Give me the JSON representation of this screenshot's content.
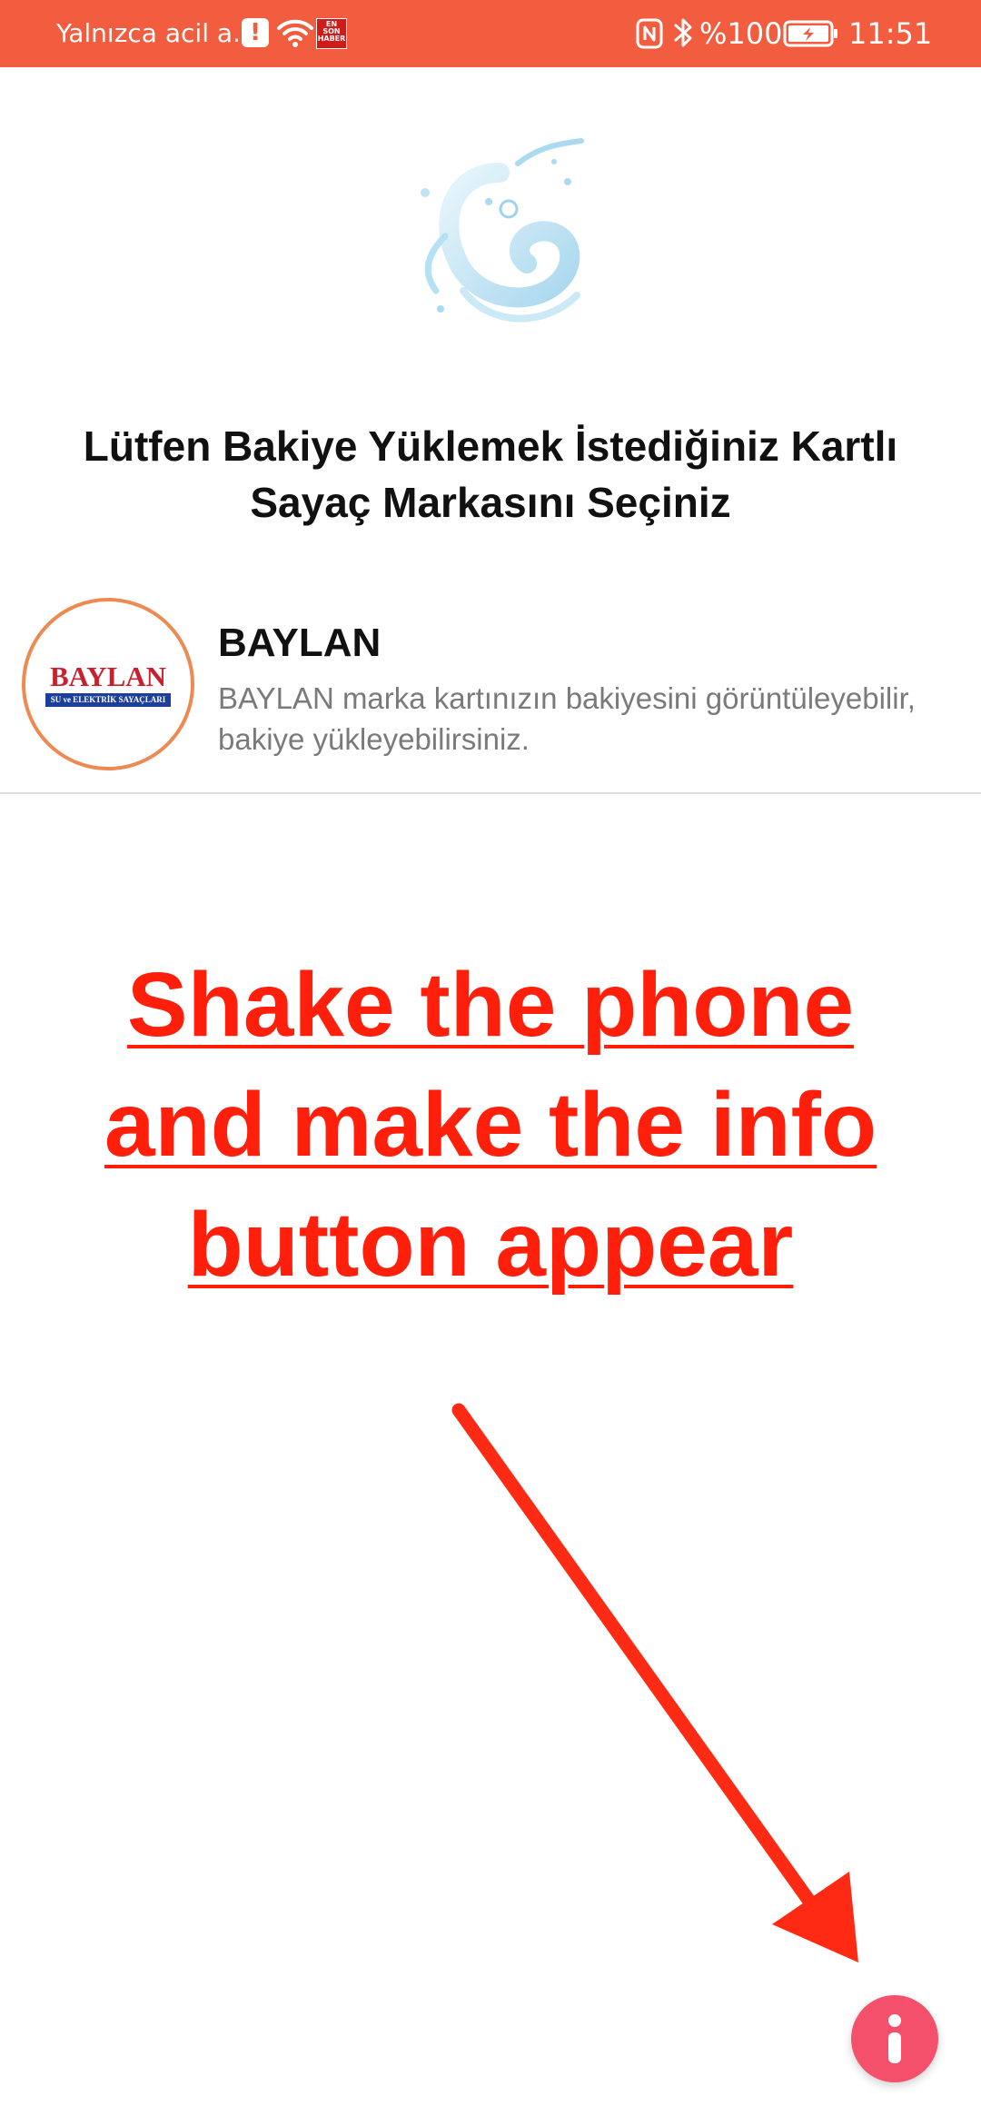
{
  "status_bar": {
    "left_text": "Yalnızca acil a...",
    "news_badge": "EN SON HABER",
    "battery_percent": "%100",
    "time": "11:51",
    "background_color": "#f25c3f"
  },
  "main": {
    "heading": "Lütfen Bakiye Yüklemek İstediğiniz Kartlı Sayaç Markasını Seçiniz",
    "brands": [
      {
        "name": "BAYLAN",
        "description": "BAYLAN marka kartınızın bakiyesini görüntüleyebilir, bakiye yükleyebilirsiniz.",
        "logo_word": "BAYLAN",
        "logo_tagline": "SU ve ELEKTRİK SAYAÇLARI"
      }
    ]
  },
  "overlay": {
    "instruction": "Shake the phone and make the info button appear",
    "color": "#ff1f0a"
  },
  "info_button": {
    "glyph": "i",
    "color": "#f4506b"
  }
}
